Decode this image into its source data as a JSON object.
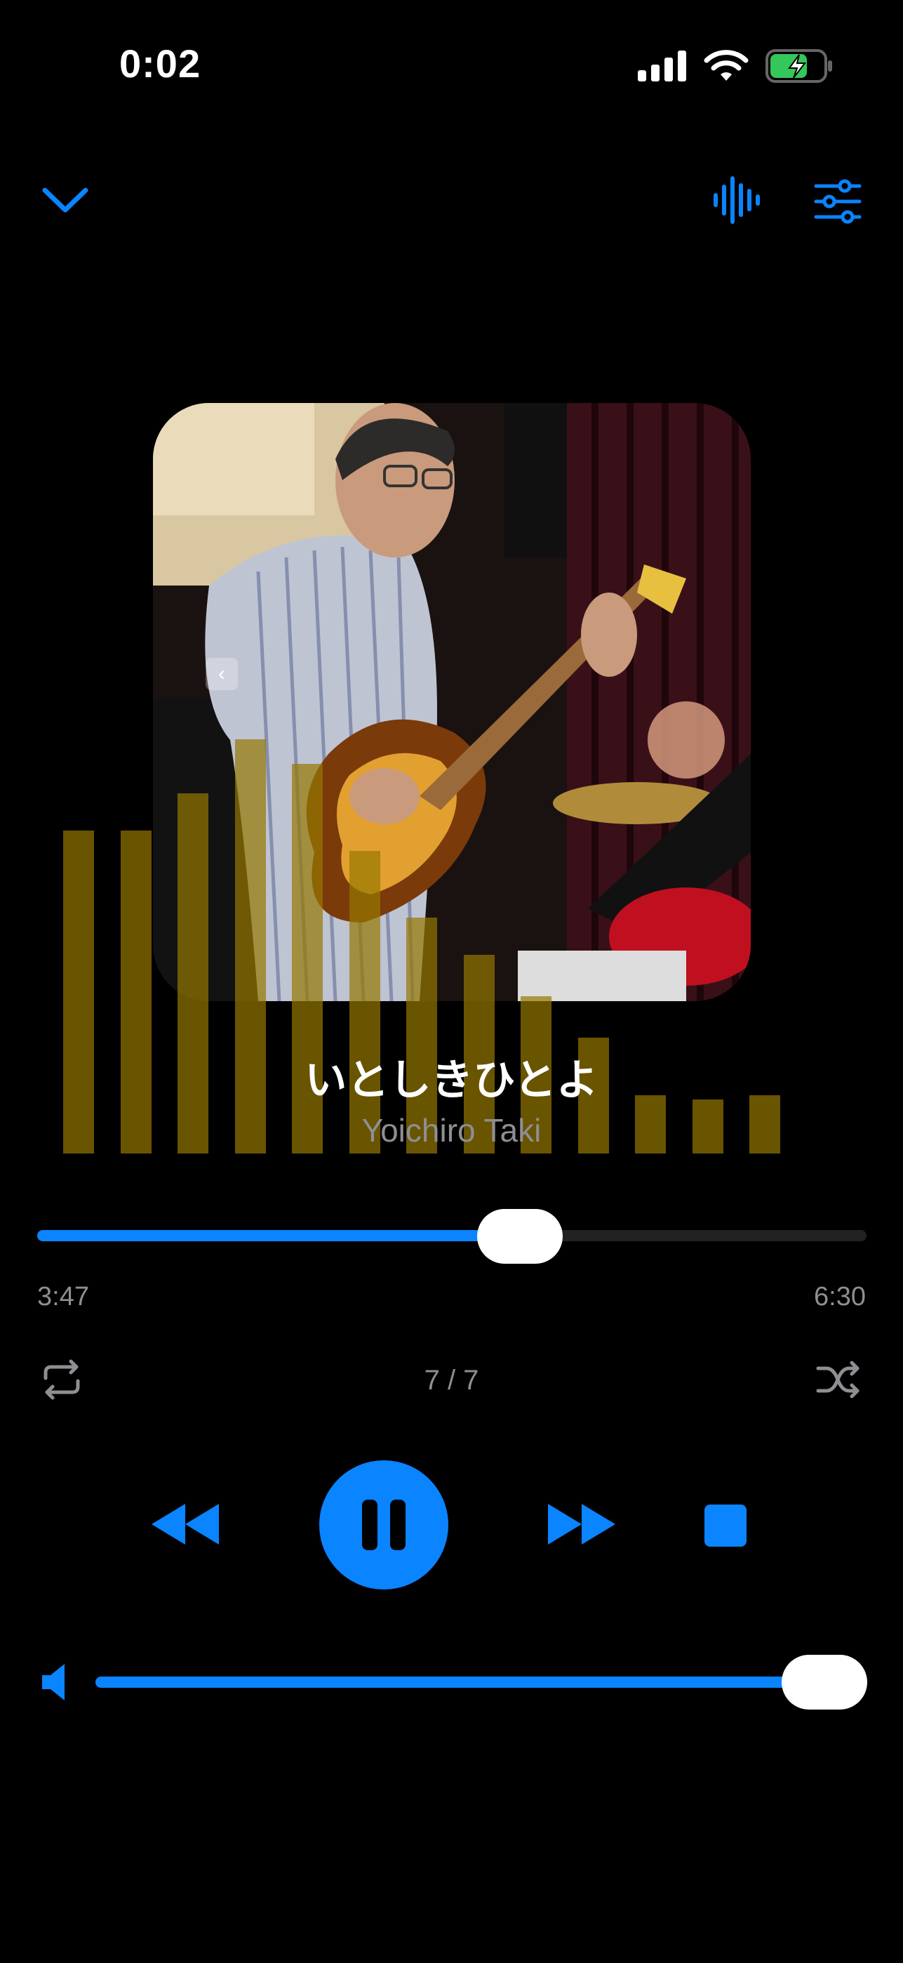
{
  "status": {
    "time": "0:02",
    "battery_level": 0.7
  },
  "icons": {
    "collapse": "chevron-down-icon",
    "visualizer": "waveform-icon",
    "settings": "sliders-icon",
    "repeat": "repeat-icon",
    "shuffle": "shuffle-icon",
    "rewind": "rewind-icon",
    "pause": "pause-icon",
    "forward": "fast-forward-icon",
    "stop": "stop-icon",
    "volume": "speaker-icon"
  },
  "colors": {
    "accent": "#0A84FF",
    "eq_bar": "#96780B",
    "secondary_text": "#8E8E93"
  },
  "track": {
    "title": "いとしきひとよ",
    "artist": "Yoichiro Taki",
    "elapsed": "3:47",
    "duration": "6:30",
    "progress": 0.582,
    "index": "7 / 7"
  },
  "volume": {
    "level": 1.0
  },
  "equalizer": {
    "levels": [
      0.78,
      0.78,
      0.87,
      1.0,
      0.94,
      0.73,
      0.57,
      0.48,
      0.38,
      0.28,
      0.14,
      0.13,
      0.14
    ]
  }
}
